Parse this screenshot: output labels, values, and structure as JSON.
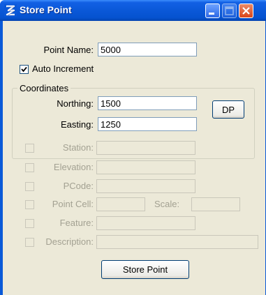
{
  "window": {
    "title": "Store Point",
    "icon": "app-logo-icon",
    "controls": [
      "minimize-icon",
      "maximize-icon",
      "close-icon"
    ]
  },
  "form": {
    "point_name": {
      "label": "Point Name:",
      "value": "5000"
    },
    "auto_increment": {
      "label": "Auto Increment",
      "checked": true
    },
    "coordinates": {
      "legend": "Coordinates",
      "northing": {
        "label": "Northing:",
        "value": "1500"
      },
      "easting": {
        "label": "Easting:",
        "value": "1250"
      },
      "dp_button": "DP"
    },
    "station": {
      "label": "Station:",
      "value": "",
      "checked": false,
      "enabled": false
    },
    "elevation": {
      "label": "Elevation:",
      "value": "",
      "checked": false,
      "enabled": false
    },
    "pcode": {
      "label": "PCode:",
      "value": "",
      "checked": false,
      "enabled": false
    },
    "point_cell": {
      "label": "Point Cell:",
      "value": "",
      "checked": false,
      "enabled": false
    },
    "scale": {
      "label": "Scale:",
      "value": "",
      "enabled": false
    },
    "feature": {
      "label": "Feature:",
      "value": "",
      "checked": false,
      "enabled": false
    },
    "description": {
      "label": "Description:",
      "value": "",
      "checked": false,
      "enabled": false
    },
    "store_button": "Store Point"
  },
  "colors": {
    "titlebar": "#0a58d8",
    "dialog_bg": "#ece9d8",
    "disabled_text": "#a3a192",
    "close_button": "#d8451a"
  }
}
